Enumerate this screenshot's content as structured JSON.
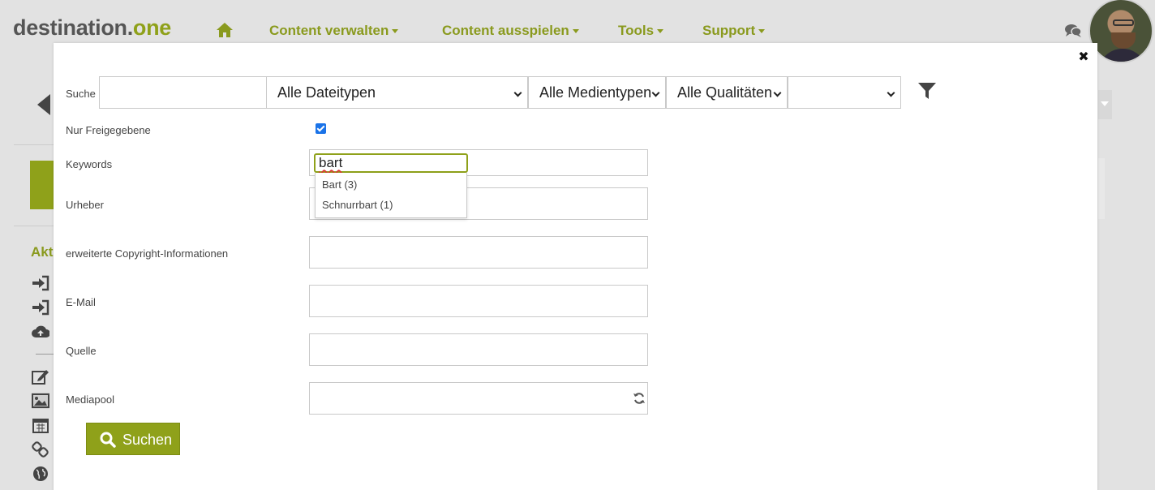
{
  "app": {
    "logo_main": "destination.",
    "logo_accent": "one"
  },
  "nav": {
    "items": [
      {
        "label": "Content verwalten"
      },
      {
        "label": "Content ausspielen"
      },
      {
        "label": "Tools"
      },
      {
        "label": "Support"
      }
    ]
  },
  "background": {
    "section_heading": "Akt"
  },
  "modal": {
    "close_glyph": "✖",
    "search": {
      "label": "Suche",
      "value": "",
      "selects": [
        {
          "value": "Alle Dateitypen"
        },
        {
          "value": "Alle Medientypen"
        },
        {
          "value": "Alle Qualitäten"
        },
        {
          "value": ""
        }
      ]
    },
    "only_approved": {
      "label": "Nur Freigegebene",
      "checked": true
    },
    "keywords": {
      "label": "Keywords",
      "value": "bart",
      "suggestions": [
        {
          "label": "Bart (3)"
        },
        {
          "label": "Schnurrbart (1)"
        }
      ]
    },
    "author": {
      "label": "Urheber",
      "value": ""
    },
    "copyright": {
      "label": "erweiterte Copyright-Informationen",
      "value": ""
    },
    "email": {
      "label": "E-Mail",
      "value": ""
    },
    "source": {
      "label": "Quelle",
      "value": ""
    },
    "mediapool": {
      "label": "Mediapool",
      "value": ""
    },
    "submit_label": "Suchen"
  },
  "colors": {
    "accent": "#8fa11a",
    "nav_text": "#8a9a1e",
    "checkbox": "#1a73e8"
  },
  "icons": [
    "home-icon",
    "chat-icon",
    "filter-icon",
    "refresh-icon",
    "search-icon",
    "close-icon",
    "sign-in-icon",
    "cloud-upload-icon",
    "edit-icon",
    "image-icon",
    "calendar-icon",
    "link-icon",
    "globe-icon"
  ]
}
